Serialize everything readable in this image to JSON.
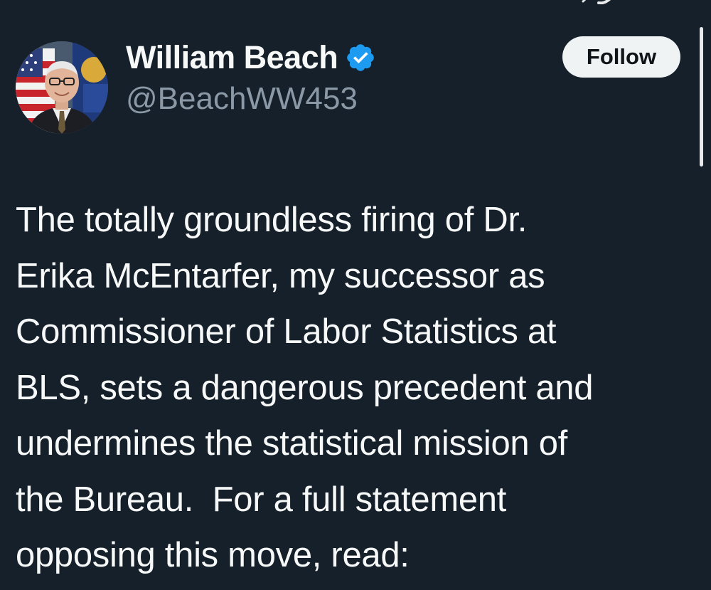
{
  "tweet": {
    "author": {
      "display_name": "William Beach",
      "handle": "@BeachWW453",
      "verified": true,
      "avatar_icon": "profile-photo"
    },
    "follow_label": "Follow",
    "text_lines": [
      "The totally groundless firing of Dr.",
      "Erika McEntarfer, my successor as",
      "Commissioner of Labor Statistics at",
      "BLS, sets a dangerous precedent and",
      "undermines the statistical mission of",
      "the Bureau.  For a full statement",
      "opposing this move, read:"
    ]
  },
  "colors": {
    "background": "#15202b",
    "text_primary": "#f7f9f9",
    "text_secondary": "#8b98a5",
    "verified_blue": "#1d9bf0",
    "follow_button_bg": "#eff3f4"
  }
}
